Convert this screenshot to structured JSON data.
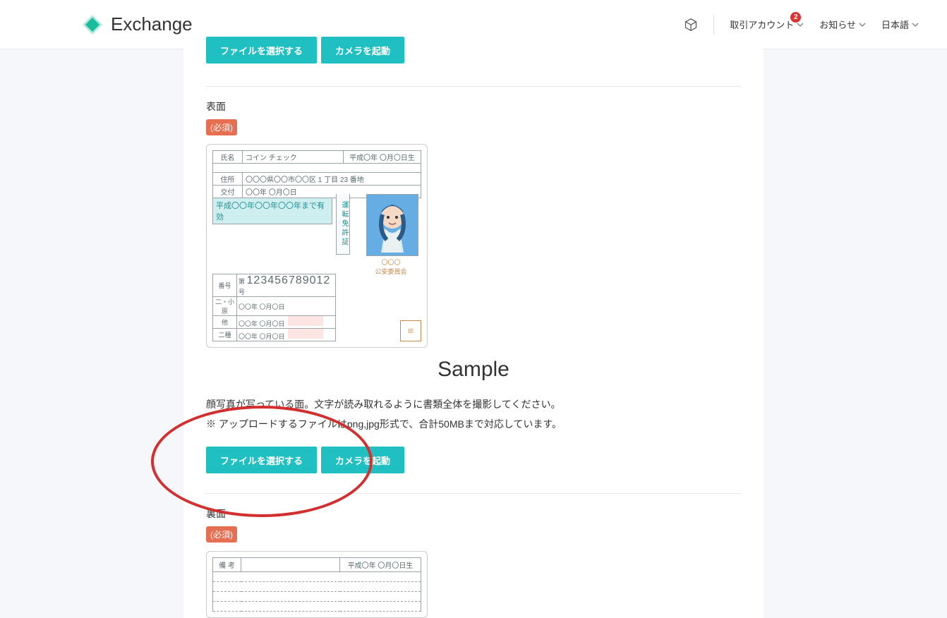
{
  "header": {
    "brand": "Exchange",
    "nav_account": "取引アカウント",
    "nav_notice": "お知らせ",
    "nav_lang": "日本語",
    "badge_count": "2"
  },
  "top_buttons": {
    "file": "ファイルを選択する",
    "camera": "カメラを起動"
  },
  "section_front": {
    "label": "表面",
    "required": "(必須)",
    "sample_text": "Sample",
    "instruction_line1": "顔写真が写っている面。文字が読み取れるように書類全体を撮影してください。",
    "instruction_line2": "※ アップロードするファイルはpng,jpg形式で、合計50MBまで対応しています。",
    "btn_file": "ファイルを選択する",
    "btn_camera": "カメラを起動"
  },
  "license_card": {
    "name_label": "氏名",
    "name_value": "コイン チェック",
    "birth": "平成〇年 〇月〇日生",
    "addr_label": "住所",
    "addr_value": "〇〇〇県〇〇市〇〇区 1 丁目 23 番地",
    "issue_label": "交付",
    "issue_value": "〇〇年 〇月〇日",
    "valid": "平成〇〇年〇〇年〇〇年まで有効",
    "license_vert": "運転免許証",
    "num_label": "番号",
    "num_prefix": "第",
    "num_value": "123456789012",
    "num_suffix": "号",
    "row_a_l": "二・小原",
    "row_a_v": "〇〇年 〇月〇日",
    "row_b_l": "他",
    "row_b_v": "〇〇年 〇月〇日",
    "row_c_l": "二種",
    "row_c_v": "〇〇年 〇月〇日",
    "stamp": "公安委員会"
  },
  "section_back": {
    "label": "裏面",
    "required": "(必須)",
    "memo_label": "備 考",
    "birth": "平成〇年 〇月〇日生"
  }
}
